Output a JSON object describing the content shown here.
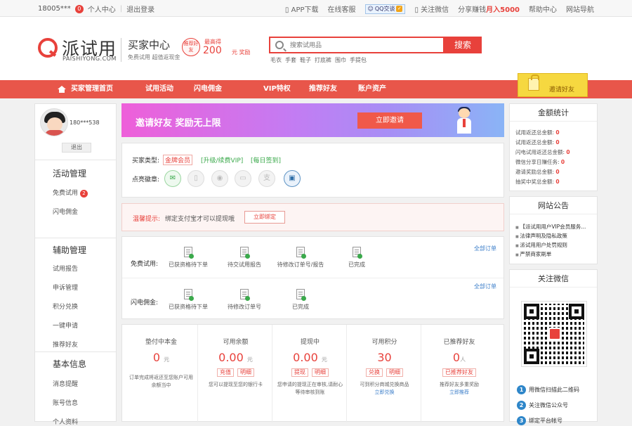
{
  "topbar": {
    "user": "18005***",
    "msg_count": "0",
    "center": "个人中心",
    "logout": "退出登录",
    "app": "APP下载",
    "service": "在线客服",
    "qq": "QQ交谈",
    "wechat": "关注微信",
    "share_prefix": "分享赚钱",
    "share_amount": "月入5000",
    "help": "帮助中心",
    "sitemap": "网站导航"
  },
  "header": {
    "logo_cn": "派试用",
    "logo_en": "PAISHIYONG.COM",
    "center_title": "买家中心",
    "center_sub": "免费试用 超值返现金",
    "promo_circle": "推荐好友",
    "promo_top": "最高得",
    "promo_amount": "200",
    "promo_unit": "元 奖励",
    "search_placeholder": "搜索试用品",
    "search_button": "搜索",
    "hot_words": [
      "毛衣",
      "手套",
      "鞋子",
      "打底裤",
      "围巾",
      "手提包"
    ]
  },
  "nav": {
    "home": "买家管理首页",
    "items": [
      "试用活动",
      "闪电佣金",
      "VIP特权",
      "推荐好友",
      "账户资产"
    ],
    "invite": "邀请好友"
  },
  "sidebar": {
    "username": "180***538",
    "logout": "退出",
    "sections": [
      {
        "title": "活动管理",
        "items": [
          "免费试用",
          "闪电佣金"
        ],
        "badge": "2"
      },
      {
        "title": "辅助管理",
        "items": [
          "试用报告",
          "申诉管理",
          "积分兑换",
          "一键申请",
          "推荐好友"
        ]
      },
      {
        "title": "基本信息",
        "items": [
          "消息提醒",
          "账号信息",
          "个人资料"
        ]
      }
    ]
  },
  "banner": {
    "text": "邀请好友  奖励无上限",
    "button": "立即邀请"
  },
  "member": {
    "type_label": "买家类型:",
    "type_value": "金牌会员",
    "upgrade": "[升级/续费VIP]",
    "signin": "[每日签到]",
    "badges_label": "点亮徽章:",
    "badges": [
      "mail-badge",
      "phone-badge",
      "wechat-badge",
      "card-badge",
      "alipay-badge",
      "photo-badge"
    ]
  },
  "tip": {
    "label": "温馨提示:",
    "text": "绑定支付宝才可以提现哦",
    "button": "立即绑定"
  },
  "orders": {
    "all": "全部订单",
    "free_label": "免费试用:",
    "free_states": [
      "已获资格待下单",
      "待交试用报告",
      "待修改订单号/报告",
      "已完成"
    ],
    "flash_label": "闪电佣金:",
    "flash_states": [
      "已获资格待下单",
      "待修改订单号",
      "已完成"
    ]
  },
  "account": {
    "cols": [
      {
        "title": "垫付中本金",
        "value": "0",
        "unit": "元",
        "buttons": [],
        "desc": "订单完成将返还至您账户可用余额当中",
        "link": ""
      },
      {
        "title": "可用余额",
        "value": "0.00",
        "unit": "元",
        "buttons": [
          "充值",
          "明细"
        ],
        "desc": "您可以提现至您的银行卡",
        "link": ""
      },
      {
        "title": "提现中",
        "value": "0.00",
        "unit": "元",
        "buttons": [
          "提现",
          "明细"
        ],
        "desc": "您申请的提现正在审核,请耐心等待审核到账",
        "link": ""
      },
      {
        "title": "可用积分",
        "value": "30",
        "unit": "",
        "buttons": [
          "兑换",
          "明细"
        ],
        "desc": "可到积分商城兑换商品",
        "link": "立即兑换"
      },
      {
        "title": "已推荐好友",
        "value": "0",
        "unit": "人",
        "buttons": [
          "已推荐好友"
        ],
        "desc": "推荐好友多重奖励",
        "link": "立即推荐"
      }
    ]
  },
  "stats": {
    "title": "金额统计",
    "lines": [
      {
        "label": "试用返还总金额:",
        "value": "0"
      },
      {
        "label": "试用返还总金额:",
        "value": "0"
      },
      {
        "label": "闪电试用返还总金额:",
        "value": "0"
      },
      {
        "label": "微信分享日赚任务:",
        "value": "0"
      },
      {
        "label": "邀请奖励总金额:",
        "value": "0"
      },
      {
        "label": "抽奖中奖总金额:",
        "value": "0"
      }
    ]
  },
  "notice": {
    "title": "网站公告",
    "items": [
      "【派试用用户VIP会员服务...",
      "法律声明及隐私政策",
      "派试用用户处罚规则",
      "严禁商家刷单"
    ]
  },
  "wechat": {
    "title": "关注微信",
    "steps": [
      "用微信扫描此二维码",
      "关注微信公众号",
      "绑定平台帐号"
    ]
  }
}
